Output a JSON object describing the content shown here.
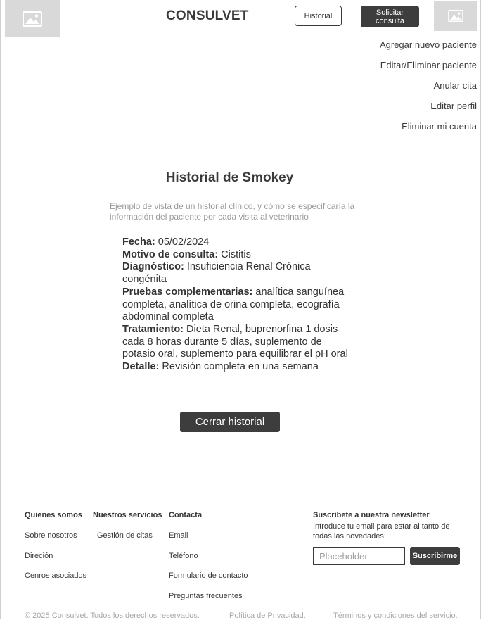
{
  "header": {
    "brand": "CONSULVET",
    "historial_label": "Historial",
    "solicitar_label_line1": "Solicitar",
    "solicitar_label_line2": "consulta"
  },
  "menu": {
    "items": [
      "Agregar nuevo paciente",
      "Editar/Eliminar paciente",
      "Anular cita",
      "Editar perfil",
      "Eliminar mi cuenta"
    ]
  },
  "card": {
    "title": "Historial de Smokey",
    "description": "Ejemplo de vista de un historial clínico, y cómo se especificaría la información del paciente por cada visita al veterinario",
    "fields": [
      {
        "label": "Fecha:",
        "value": " 05/02/2024"
      },
      {
        "label": "Motivo de consulta:",
        "value": " Cistitis"
      },
      {
        "label": "Diagnóstico:",
        "value": " Insuficiencia Renal Crónica congénita"
      },
      {
        "label": "Pruebas complementarias:",
        "value": " analítica sanguínea completa, analítica de orina completa, ecografía abdominal completa"
      },
      {
        "label": "Tratamiento:",
        "value": " Dieta Renal, buprenorfina 1 dosis cada 8 horas durante 5 días, suplemento de potasio oral, suplemento para equilibrar el pH oral"
      },
      {
        "label": "Detalle:",
        "value": " Revisión completa en una semana"
      }
    ],
    "close_label": "Cerrar historial"
  },
  "footer": {
    "col1": {
      "heading": "Quienes somos",
      "links": [
        "Sobre nosotros",
        "Direción",
        "Cenros asociados"
      ]
    },
    "col2": {
      "heading": "Nuestros servicios",
      "links": [
        "Gestión de citas"
      ]
    },
    "col3": {
      "heading": "Contacta",
      "links": [
        "Email",
        "Teléfono",
        "Formulario de contacto",
        "Preguntas frecuentes"
      ]
    },
    "newsletter": {
      "heading": "Suscríbete a nuestra newsletter",
      "description": "Introduce tu email para estar al tanto de todas las novedades:",
      "placeholder": "Placeholder",
      "button_label": "Suscribirme"
    },
    "copyright": "© 2025 Consulvet. Todos los derechos reservados.",
    "privacy": "Política de Privacidad.",
    "terms": "Términos y condiciones del servicio."
  },
  "icons": {
    "logo_left": "image-placeholder-icon",
    "logo_right": "image-placeholder-icon"
  },
  "colors": {
    "dark_button": "#3d3d3d",
    "placeholder_bg": "#d9d9d9",
    "muted_text": "#9a9a9a"
  }
}
